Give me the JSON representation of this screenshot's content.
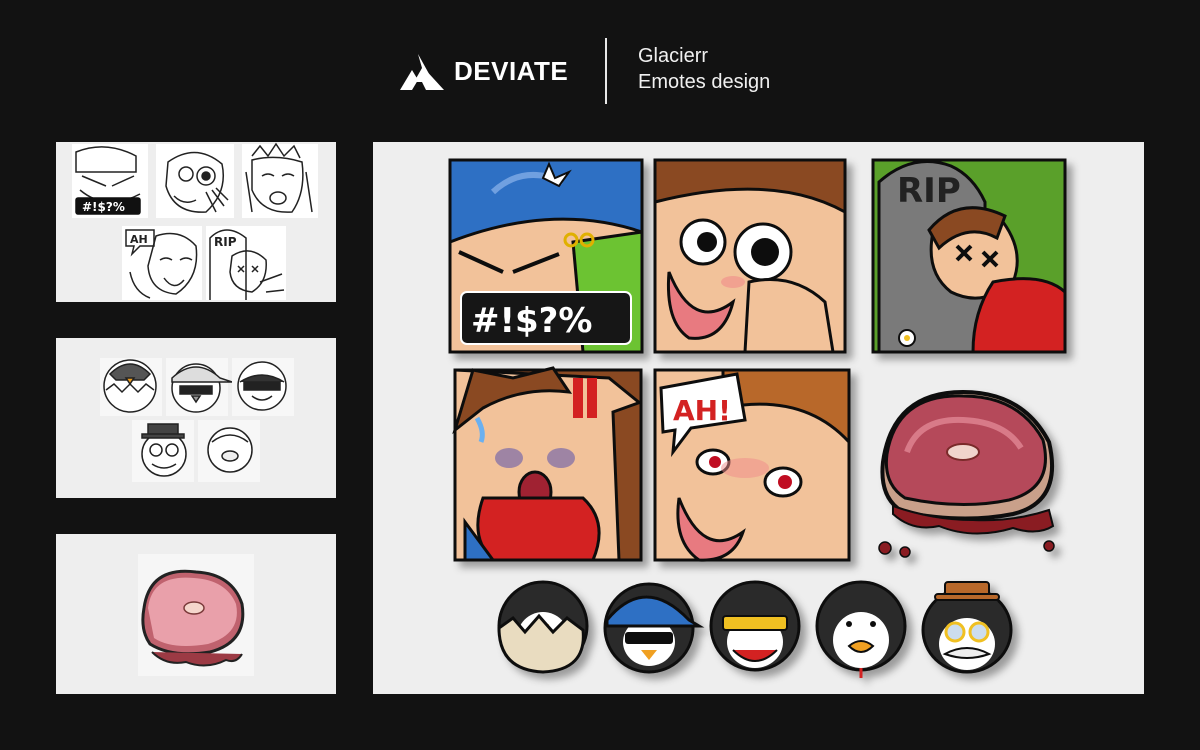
{
  "header": {
    "brand": "DEVIATE",
    "client": "Glacierr",
    "project": "Emotes design"
  },
  "sketches": {
    "rage_text": "#!$?%",
    "ah_text": "AH",
    "rip_text": "RIP"
  },
  "emotes": {
    "rage_text": "#!$?%",
    "rip_text": "RIP",
    "ah_text": "AH!"
  },
  "colors": {
    "background": "#121212",
    "panel": "#eeeeee",
    "text": "#ffffff",
    "cap_blue": "#2f6fc4",
    "shirt_red": "#d32020",
    "hair_brown": "#8a4a22",
    "skin": "#f2c29a",
    "steak": "#b5485a"
  }
}
